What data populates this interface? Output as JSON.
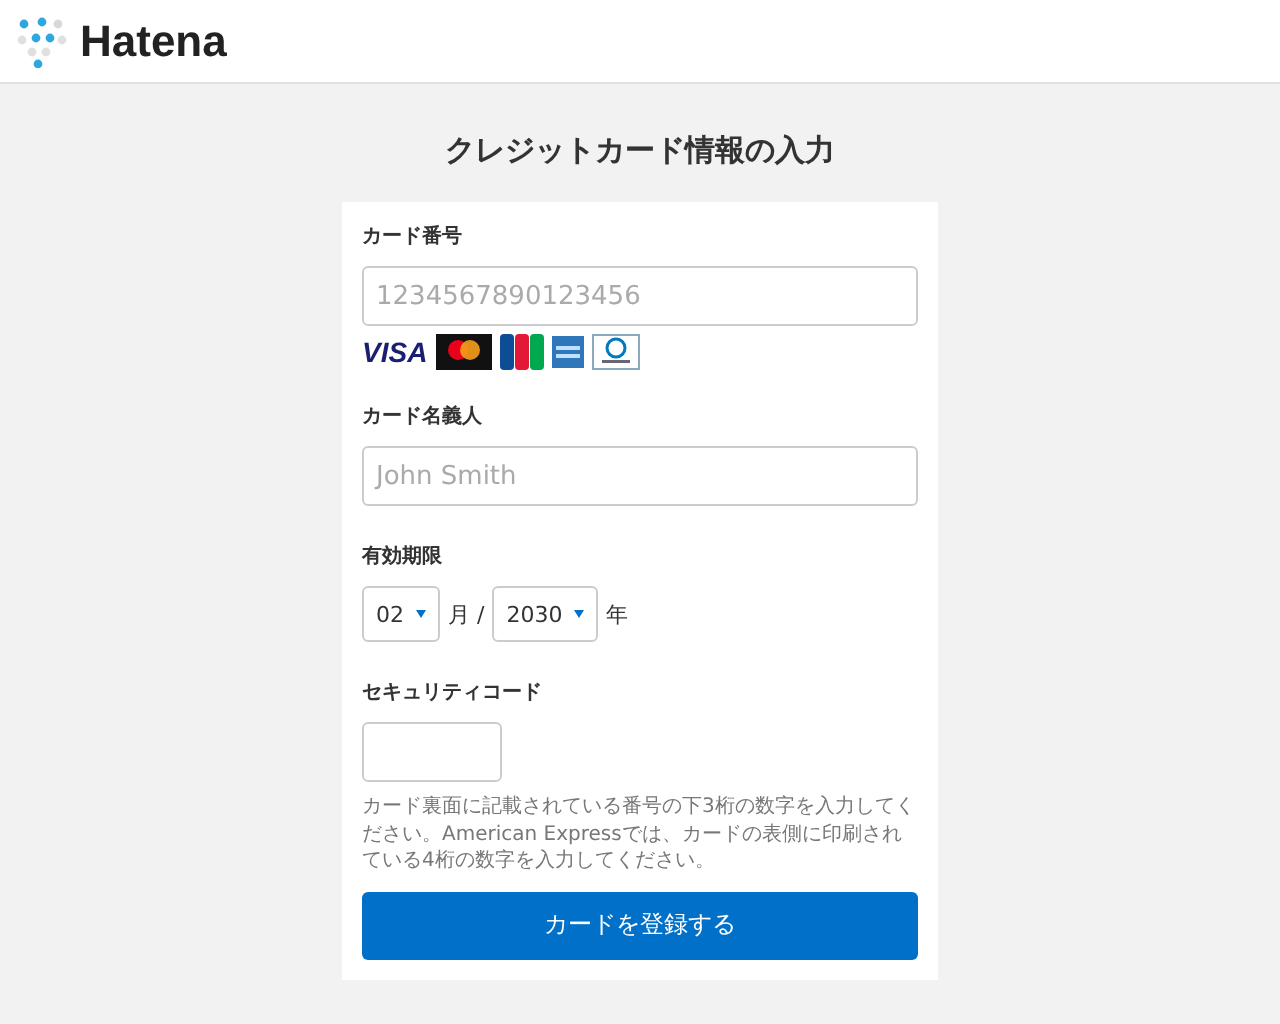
{
  "header": {
    "logo_text": "Hatena"
  },
  "title": "クレジットカード情報の入力",
  "form": {
    "card_number": {
      "label": "カード番号",
      "placeholder": "1234567890123456"
    },
    "brands": [
      {
        "kind": "visa",
        "text": "VISA"
      },
      {
        "kind": "mastercard"
      },
      {
        "kind": "jcb"
      },
      {
        "kind": "amex"
      },
      {
        "kind": "diners"
      }
    ],
    "holder": {
      "label": "カード名義人",
      "placeholder": "John Smith"
    },
    "expiry": {
      "label": "有効期限",
      "month": "02",
      "month_unit": "月 /",
      "year": "2030",
      "year_unit": "年"
    },
    "security": {
      "label": "セキュリティコード",
      "note": "カード裏面に記載されている番号の下3桁の数字を入力してください。American Expressでは、カードの表側に印刷されている4桁の数字を入力してください。"
    },
    "submit": "カードを登録する"
  }
}
